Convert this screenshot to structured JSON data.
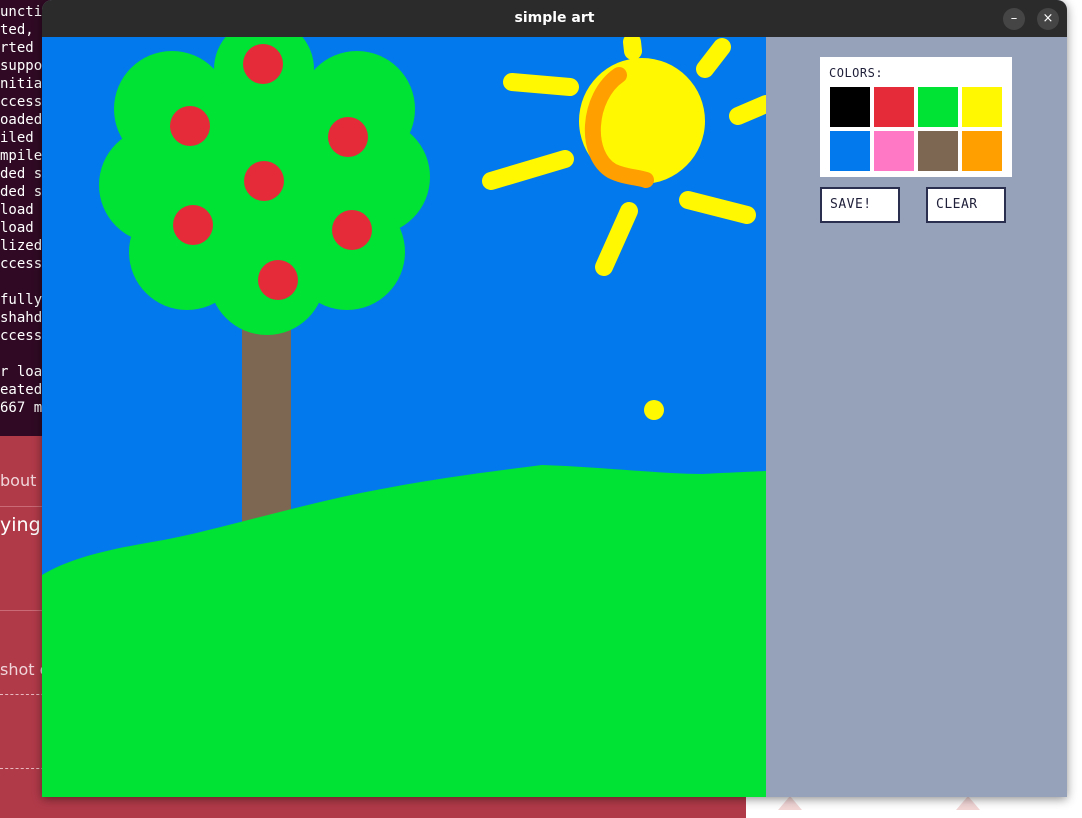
{
  "window": {
    "title": "simple art",
    "minimize_glyph": "–",
    "close_glyph": "×"
  },
  "terminal": {
    "lines": [
      "uncti",
      "ted,",
      "rted",
      "suppo",
      "nitia",
      "ccess",
      "oaded",
      "iled",
      "mpile",
      "ded s",
      "ded s",
      " load",
      " load",
      "lized",
      "ccess",
      "",
      "fully",
      "shahd",
      "ccess",
      "",
      "r loa",
      "eated",
      "667 m"
    ]
  },
  "background_page": {
    "about": "bout",
    "desc": "ying c",
    "shot": "shot c"
  },
  "palette": {
    "title": "COLORS:",
    "colors": [
      {
        "name": "black",
        "hex": "#000000"
      },
      {
        "name": "red",
        "hex": "#e52a3a"
      },
      {
        "name": "green",
        "hex": "#00e234"
      },
      {
        "name": "yellow",
        "hex": "#fff800"
      },
      {
        "name": "blue",
        "hex": "#0279ec"
      },
      {
        "name": "pink",
        "hex": "#ff78c5"
      },
      {
        "name": "brown",
        "hex": "#7e6752"
      },
      {
        "name": "orange",
        "hex": "#ff9f00"
      }
    ]
  },
  "buttons": {
    "save_label": "SAVE!",
    "clear_label": "CLEAR"
  },
  "canvas_colors": {
    "sky": "#0279ec",
    "grass": "#00e234",
    "trunk": "#7e6752",
    "apple": "#e52a3a",
    "sun": "#fff800",
    "sun_arc": "#ff9f00"
  }
}
